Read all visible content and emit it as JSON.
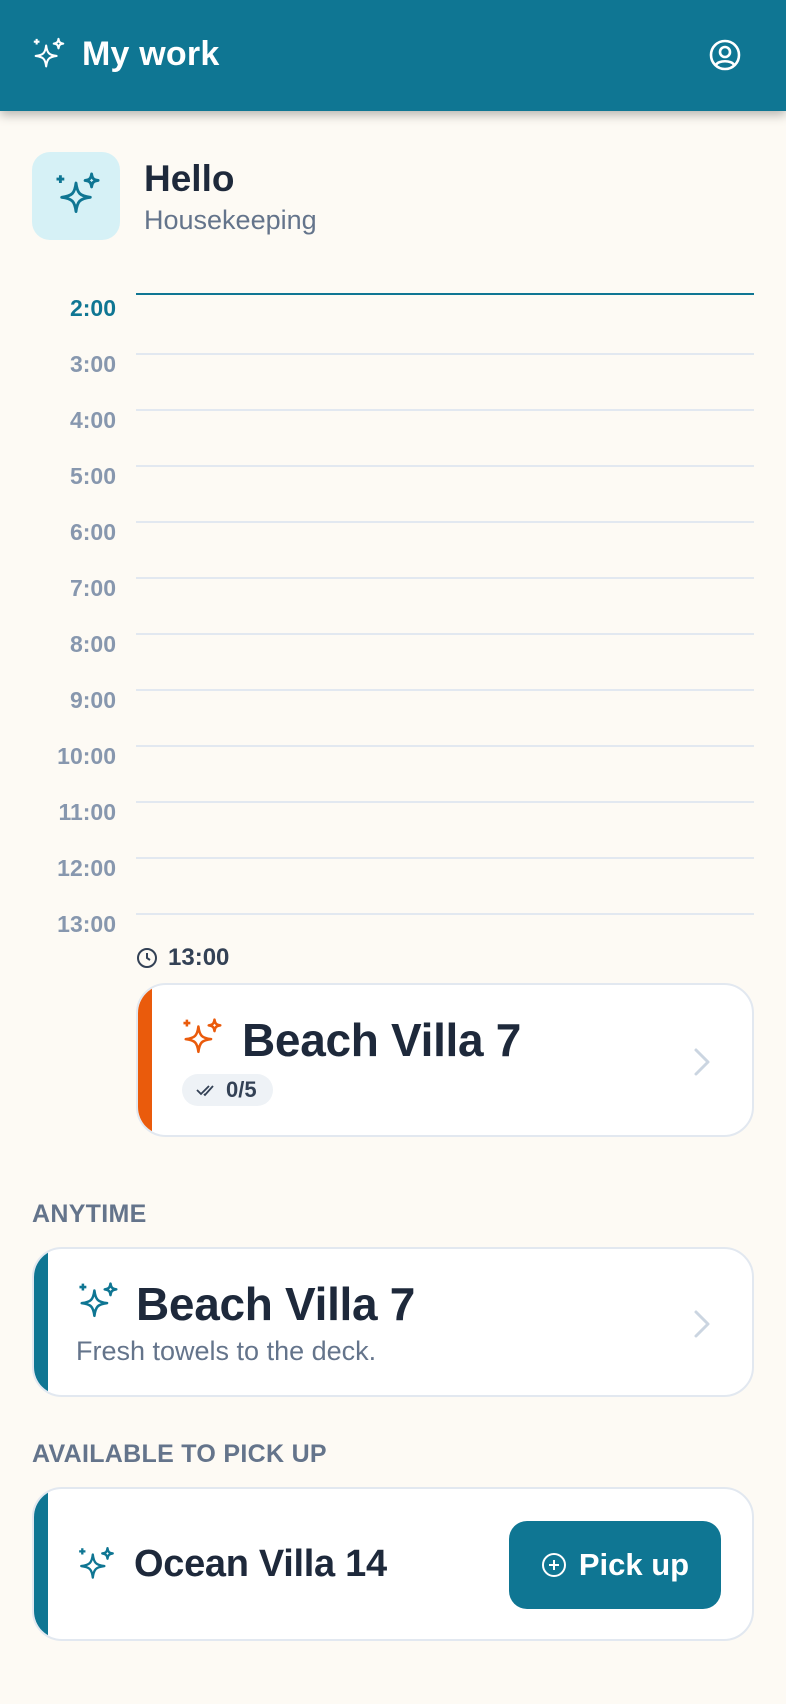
{
  "header": {
    "title": "My work",
    "logo_icon": "sparkles-icon",
    "profile_icon": "user-circle-icon"
  },
  "greeting": {
    "title": "Hello",
    "subtitle": "Housekeeping",
    "icon": "sparkles-icon"
  },
  "timeline": {
    "hours": [
      "2:00",
      "3:00",
      "4:00",
      "5:00",
      "6:00",
      "7:00",
      "8:00",
      "9:00",
      "10:00",
      "11:00",
      "12:00",
      "13:00"
    ],
    "current_hour": "2:00"
  },
  "scheduled_task": {
    "time": "13:00",
    "title": "Beach Villa 7",
    "progress": "0/5",
    "accent": "#ea5b0c",
    "icon": "sparkles-icon"
  },
  "anytime": {
    "label": "ANYTIME",
    "task": {
      "title": "Beach Villa 7",
      "note": "Fresh towels to the deck.",
      "accent": "#0f7693",
      "icon": "sparkles-icon"
    }
  },
  "available": {
    "label": "AVAILABLE TO PICK UP",
    "task": {
      "title": "Ocean Villa 14",
      "button_label": "Pick up",
      "button_icon": "plus-circle-icon",
      "accent": "#0f7693"
    }
  },
  "colors": {
    "brand": "#0f7693",
    "background": "#fdfaf4",
    "warning_accent": "#ea5b0c"
  }
}
